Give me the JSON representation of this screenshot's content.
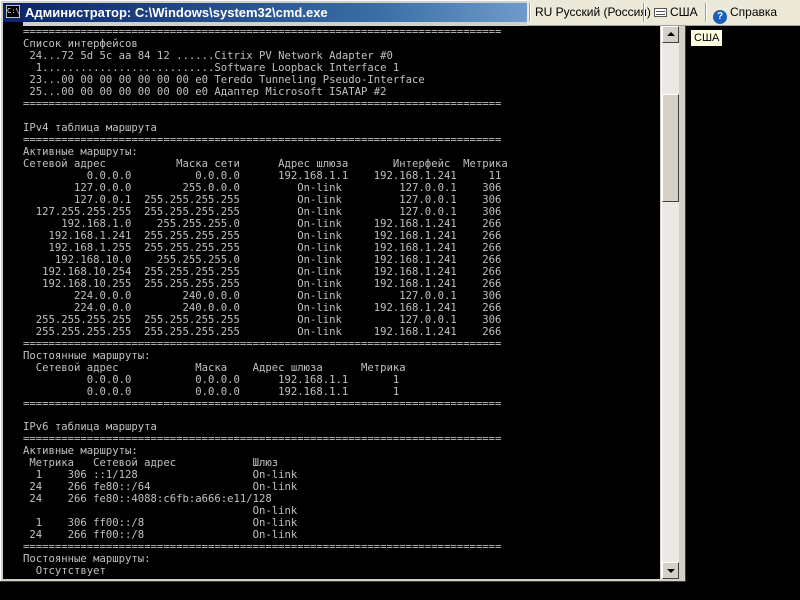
{
  "window": {
    "title": "Администратор: C:\\Windows\\system32\\cmd.exe",
    "icon_name": "console-app-icon",
    "icon_glyph": "C:\\"
  },
  "console": {
    "foreground": "#c0c0c0",
    "background": "#000000",
    "lines": [
      "===========================================================================",
      "Список интерфейсов",
      " 24...72 5d 5c aa 84 12 ......Citrix PV Network Adapter #0",
      "  1...........................Software Loopback Interface 1",
      " 23...00 00 00 00 00 00 00 e0 Teredo Tunneling Pseudo-Interface",
      " 25...00 00 00 00 00 00 00 e0 Адаптер Microsoft ISATAP #2",
      "===========================================================================",
      "",
      "IPv4 таблица маршрута",
      "===========================================================================",
      "Активные маршруты:",
      "Сетевой адрес           Маска сети      Адрес шлюза       Интерфейс  Метрика",
      "          0.0.0.0          0.0.0.0      192.168.1.1    192.168.1.241     11",
      "        127.0.0.0        255.0.0.0         On-link         127.0.0.1    306",
      "        127.0.0.1  255.255.255.255         On-link         127.0.0.1    306",
      "  127.255.255.255  255.255.255.255         On-link         127.0.0.1    306",
      "      192.168.1.0    255.255.255.0         On-link     192.168.1.241    266",
      "    192.168.1.241  255.255.255.255         On-link     192.168.1.241    266",
      "    192.168.1.255  255.255.255.255         On-link     192.168.1.241    266",
      "     192.168.10.0    255.255.255.0         On-link     192.168.1.241    266",
      "   192.168.10.254  255.255.255.255         On-link     192.168.1.241    266",
      "   192.168.10.255  255.255.255.255         On-link     192.168.1.241    266",
      "        224.0.0.0        240.0.0.0         On-link         127.0.0.1    306",
      "        224.0.0.0        240.0.0.0         On-link     192.168.1.241    266",
      "  255.255.255.255  255.255.255.255         On-link         127.0.0.1    306",
      "  255.255.255.255  255.255.255.255         On-link     192.168.1.241    266",
      "===========================================================================",
      "Постоянные маршруты:",
      "  Сетевой адрес            Маска    Адрес шлюза      Метрика",
      "          0.0.0.0          0.0.0.0      192.168.1.1       1",
      "          0.0.0.0          0.0.0.0      192.168.1.1       1",
      "===========================================================================",
      "",
      "IPv6 таблица маршрута",
      "===========================================================================",
      "Активные маршруты:",
      " Метрика   Сетевой адрес            Шлюз",
      "  1    306 ::1/128                  On-link",
      " 24    266 fe80::/64                On-link",
      " 24    266 fe80::4088:c6fb:a666:e11/128",
      "                                    On-link",
      "  1    306 ff00::/8                 On-link",
      " 24    266 ff00::/8                 On-link",
      "===========================================================================",
      "Постоянные маршруты:",
      "  Отсутствует"
    ]
  },
  "langbar": {
    "language_label": "RU Русский (Россия)",
    "layout_label": "США",
    "help_label": "Справка",
    "help_glyph": "?",
    "keyboard_icon": "keyboard-icon",
    "help_icon": "help-icon"
  },
  "tooltip": {
    "text": "США"
  },
  "colors": {
    "title_gradient_start": "#0a246a",
    "title_gradient_end": "#a6caf0",
    "window_face": "#d4d0c8",
    "langbar_face": "#ece9d8"
  }
}
